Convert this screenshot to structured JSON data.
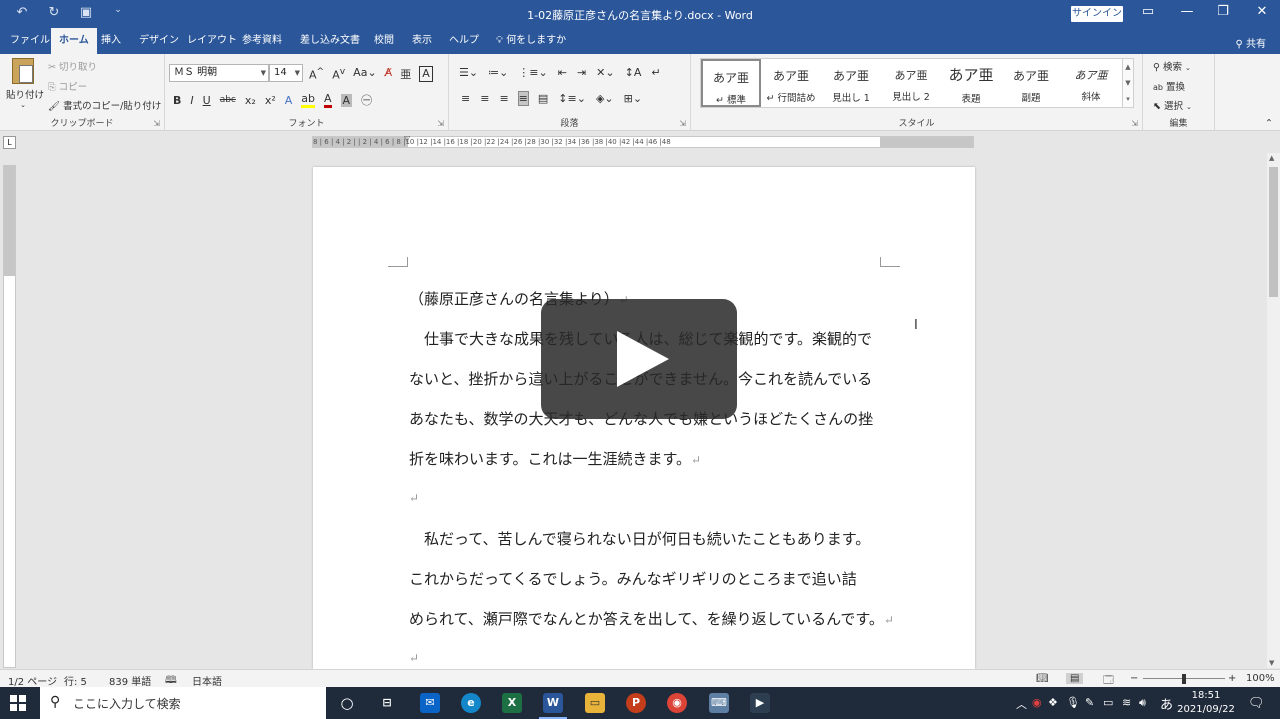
{
  "window": {
    "title": "1-02藤原正彦さんの名言集より.docx  -  Word",
    "signin": "サインイン"
  },
  "ribbon_tabs": [
    "ファイル",
    "ホーム",
    "挿入",
    "デザイン",
    "レイアウト",
    "参考資料",
    "差し込み文書",
    "校閲",
    "表示",
    "ヘルプ",
    "何をしますか"
  ],
  "share": "共有",
  "clipboard": {
    "paste": "貼り付け",
    "cut": "切り取り",
    "copy": "コピー",
    "format_painter": "書式のコピー/貼り付け",
    "label": "クリップボード"
  },
  "font": {
    "name": "ＭＳ 明朝",
    "size": "14",
    "label": "フォント"
  },
  "paragraph": {
    "label": "段落"
  },
  "styles": {
    "label": "スタイル",
    "items": [
      {
        "sample": "あア亜",
        "name": "標準"
      },
      {
        "sample": "あア亜",
        "name": "行間詰め"
      },
      {
        "sample": "あア亜",
        "name": "見出し 1"
      },
      {
        "sample": "あア亜",
        "name": "見出し 2"
      },
      {
        "sample": "あア亜",
        "name": "表題"
      },
      {
        "sample": "あア亜",
        "name": "副題"
      },
      {
        "sample": "あア亜",
        "name": "斜体"
      }
    ]
  },
  "editing": {
    "find": "検索",
    "replace": "置換",
    "select": "選択",
    "label": "編集"
  },
  "ruler": {
    "h_ticks": "8 | 6 | 4 | 2 |  | 2 | 4 | 6 | 8 |10 |12 |14 |16 |18 |20 |22 |24 |26 |28 |30 |32 |34 |36 |38 |40 |42 |44 |46 |48"
  },
  "document": {
    "paragraphs": [
      "（藤原正彦さんの名言集より）",
      "　仕事で大きな成果を残している人は、総じて楽観的です。楽観的で",
      "ないと、挫折から這い上がることができません。今これを読んでいる",
      "あなたも、数学の大天才も、どんな人でも嫌というほどたくさんの挫",
      "折を味わいます。これは一生涯続きます。",
      "",
      "　私だって、苦しんで寝られない日が何日も続いたこともあります。",
      "これからだってくるでしょう。みんなギリギリのところまで追い詰",
      "められて、瀬戸際でなんとか答えを出して、を繰り返しているんです。",
      ""
    ],
    "para_mark": "↵"
  },
  "status": {
    "page": "1/2 ページ",
    "line": "行: 5",
    "words": "839 単語",
    "language": "日本語",
    "zoom": "100%",
    "zoom_level": 1.0
  },
  "taskbar": {
    "search_placeholder": "ここに入力して検索",
    "ime": "あ",
    "time": "18:51",
    "date": "2021/09/22"
  }
}
